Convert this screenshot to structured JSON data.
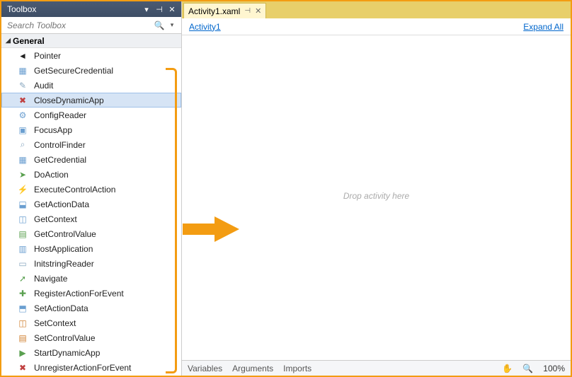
{
  "toolbox": {
    "title": "Toolbox",
    "search_placeholder": "Search Toolbox",
    "category": "General",
    "items": [
      {
        "label": "Pointer",
        "icon": "◄",
        "iconColor": "#222"
      },
      {
        "label": "GetSecureCredential",
        "icon": "▦",
        "iconColor": "#6a9ed0"
      },
      {
        "label": "Audit",
        "icon": "✎",
        "iconColor": "#8aa8c0"
      },
      {
        "label": "CloseDynamicApp",
        "icon": "✖",
        "iconColor": "#c04040",
        "selected": true
      },
      {
        "label": "ConfigReader",
        "icon": "⚙",
        "iconColor": "#6a9ed0"
      },
      {
        "label": "FocusApp",
        "icon": "▣",
        "iconColor": "#6a9ed0"
      },
      {
        "label": "ControlFinder",
        "icon": "⌕",
        "iconColor": "#8aa8c0"
      },
      {
        "label": "GetCredential",
        "icon": "▦",
        "iconColor": "#6a9ed0"
      },
      {
        "label": "DoAction",
        "icon": "➤",
        "iconColor": "#5aa050"
      },
      {
        "label": "ExecuteControlAction",
        "icon": "⚡",
        "iconColor": "#d08030"
      },
      {
        "label": "GetActionData",
        "icon": "⬓",
        "iconColor": "#6a9ed0"
      },
      {
        "label": "GetContext",
        "icon": "◫",
        "iconColor": "#6a9ed0"
      },
      {
        "label": "GetControlValue",
        "icon": "▤",
        "iconColor": "#5aa050"
      },
      {
        "label": "HostApplication",
        "icon": "▥",
        "iconColor": "#6a9ed0"
      },
      {
        "label": "InitstringReader",
        "icon": "▭",
        "iconColor": "#8aa8c0"
      },
      {
        "label": "Navigate",
        "icon": "➚",
        "iconColor": "#5aa050"
      },
      {
        "label": "RegisterActionForEvent",
        "icon": "✚",
        "iconColor": "#5aa050"
      },
      {
        "label": "SetActionData",
        "icon": "⬒",
        "iconColor": "#6a9ed0"
      },
      {
        "label": "SetContext",
        "icon": "◫",
        "iconColor": "#d08030"
      },
      {
        "label": "SetControlValue",
        "icon": "▤",
        "iconColor": "#d08030"
      },
      {
        "label": "StartDynamicApp",
        "icon": "▶",
        "iconColor": "#5aa050"
      },
      {
        "label": "UnregisterActionForEvent",
        "icon": "✖",
        "iconColor": "#c04040"
      }
    ]
  },
  "designer": {
    "tab_label": "Activity1.xaml",
    "breadcrumb": "Activity1",
    "expand_all": "Expand All",
    "drop_hint": "Drop activity here",
    "bottom_tabs": [
      "Variables",
      "Arguments",
      "Imports"
    ],
    "zoom": "100%"
  }
}
